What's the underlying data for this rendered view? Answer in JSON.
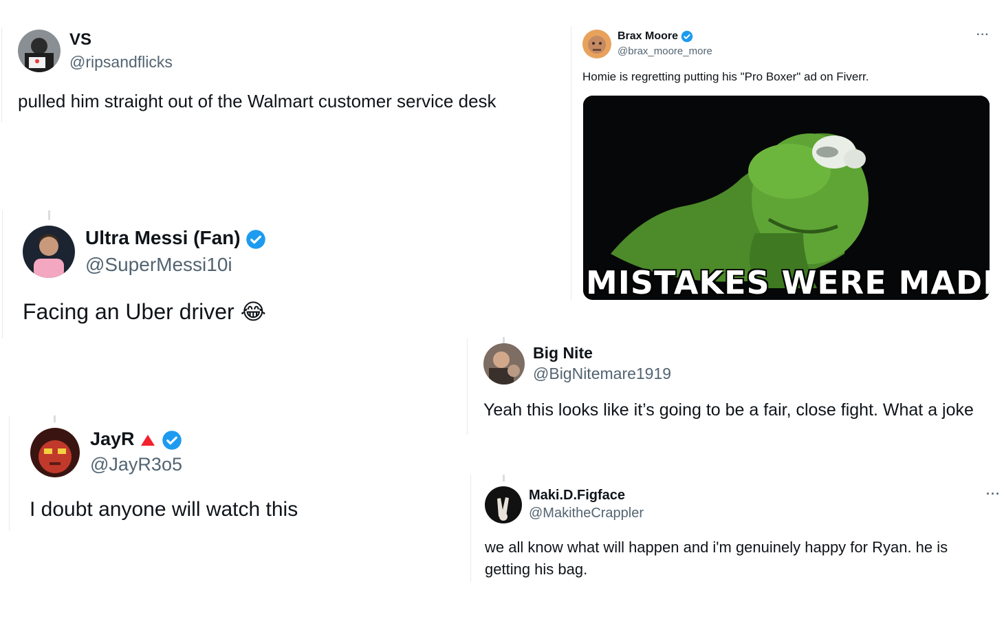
{
  "tweets": [
    {
      "name": "VS",
      "handle": "@ripsandflicks",
      "text": "pulled him straight out of the Walmart customer service desk"
    },
    {
      "name": "Brax Moore",
      "handle": "@brax_moore_more",
      "text": "Homie is regretting putting his \"Pro Boxer\" ad on Fiverr.",
      "media_caption": "MISTAKES WERE MADE",
      "menu": "···"
    },
    {
      "name": "Ultra Messi (Fan)",
      "handle": "@SuperMessi10i",
      "text": "Facing an Uber driver 😂"
    },
    {
      "name": "Big Nite",
      "handle": "@BigNitemare1919",
      "text": "Yeah this looks like it’s going to be a fair, close fight. What a joke"
    },
    {
      "name": "JayR",
      "handle": "@JayR3o5",
      "text": "I doubt anyone will watch this"
    },
    {
      "name": "Maki.D.Figface",
      "handle": "@MakitheCrappler",
      "text": "we all know what will happen and i'm genuinely happy for Ryan. he is getting his bag.",
      "menu": "···"
    }
  ],
  "colors": {
    "verified": "#1d9bf0",
    "accent_red": "#f4212e",
    "handle": "#536471"
  },
  "icons": {
    "verified": "verified-badge-icon",
    "menu": "more-options-icon",
    "triangle": "red-triangle-icon"
  }
}
